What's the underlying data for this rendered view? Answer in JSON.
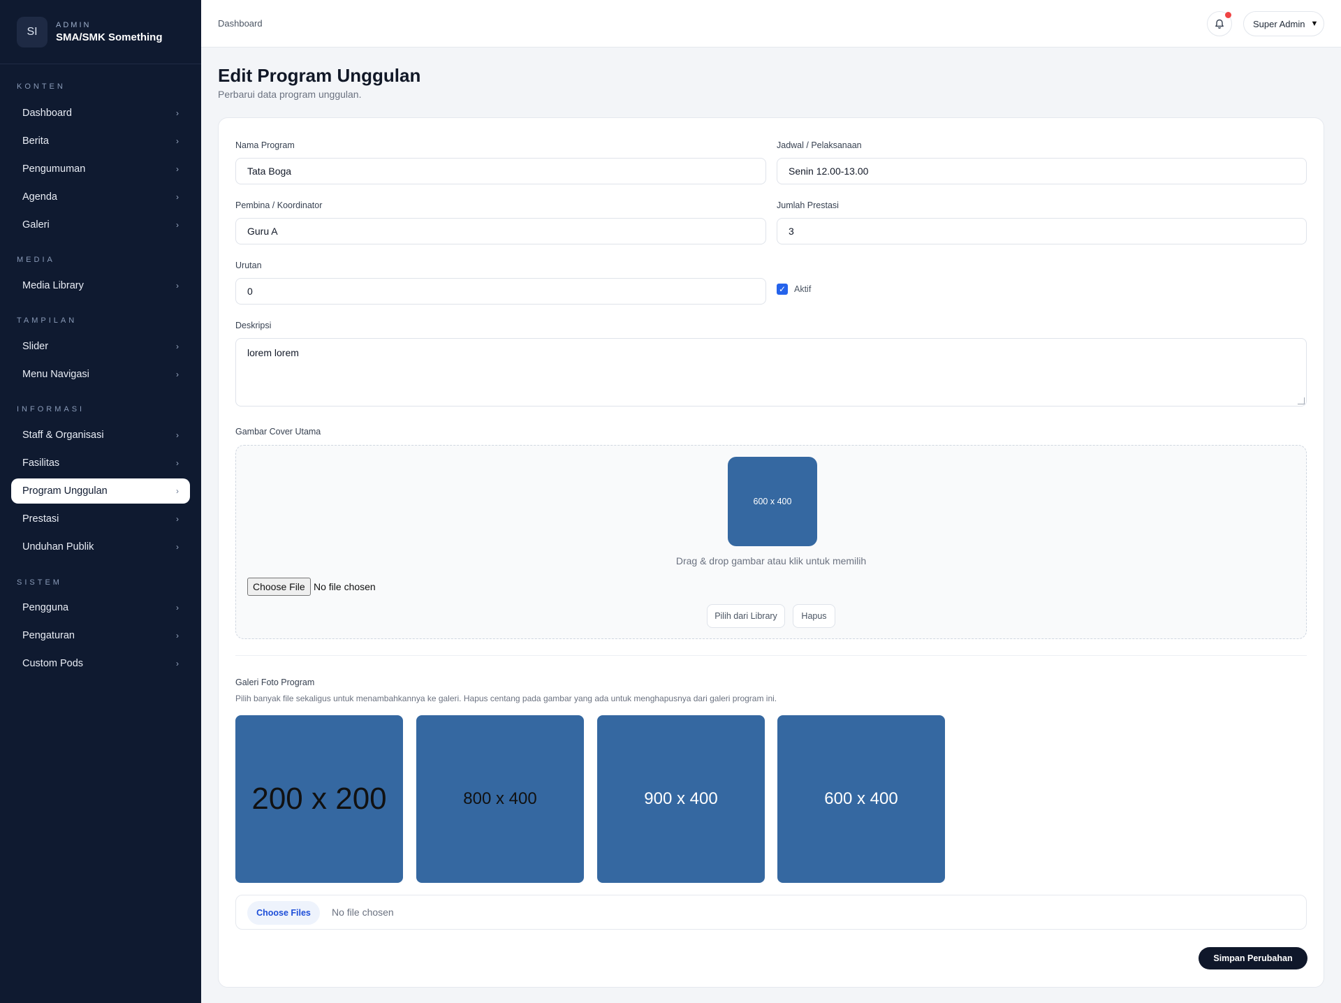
{
  "brand": {
    "logo": "SI",
    "kicker": "ADMIN",
    "name": "SMA/SMK Something"
  },
  "sidebar": {
    "sections": [
      {
        "title": "KONTEN",
        "items": [
          "Dashboard",
          "Berita",
          "Pengumuman",
          "Agenda",
          "Galeri"
        ]
      },
      {
        "title": "MEDIA",
        "items": [
          "Media Library"
        ]
      },
      {
        "title": "TAMPILAN",
        "items": [
          "Slider",
          "Menu Navigasi"
        ]
      },
      {
        "title": "INFORMASI",
        "items": [
          "Staff & Organisasi",
          "Fasilitas",
          "Program Unggulan",
          "Prestasi",
          "Unduhan Publik"
        ]
      },
      {
        "title": "SISTEM",
        "items": [
          "Pengguna",
          "Pengaturan",
          "Custom Pods"
        ]
      }
    ],
    "active": "Program Unggulan",
    "chevron": "›"
  },
  "topbar": {
    "breadcrumb": "Dashboard",
    "bell_icon": "bell-icon",
    "user": "Super Admin",
    "caret": "▼"
  },
  "page": {
    "title": "Edit Program Unggulan",
    "subtitle": "Perbarui data program unggulan."
  },
  "form": {
    "nama_program": {
      "label": "Nama Program",
      "value": "Tata Boga"
    },
    "jadwal": {
      "label": "Jadwal / Pelaksanaan",
      "value": "Senin 12.00-13.00"
    },
    "pembina": {
      "label": "Pembina / Koordinator",
      "value": "Guru A"
    },
    "jumlah_prestasi": {
      "label": "Jumlah Prestasi",
      "value": "3"
    },
    "urutan": {
      "label": "Urutan",
      "value": "0"
    },
    "aktif": {
      "label": "Aktif",
      "checked": true,
      "mark": "✓"
    },
    "deskripsi": {
      "label": "Deskripsi",
      "value": "lorem lorem"
    }
  },
  "cover": {
    "label": "Gambar Cover Utama",
    "image_text": "600 x 400",
    "dropzone_text": "Drag & drop gambar atau klik untuk memilih",
    "file_button": "Choose File",
    "file_status": "No file chosen",
    "library_button": "Pilih dari Library",
    "remove_button": "Hapus"
  },
  "gallery": {
    "title": "Galeri Foto Program",
    "subtitle": "Pilih banyak file sekaligus untuk menambahkannya ke galeri. Hapus centang pada gambar yang ada untuk menghapusnya dari galeri program ini.",
    "images": [
      {
        "text": "200 x 200",
        "color": "#111111"
      },
      {
        "text": "800 x 400",
        "color": "#111111"
      },
      {
        "text": "900 x 400",
        "color": "#ffffff"
      },
      {
        "text": "600 x 400",
        "color": "#ffffff"
      }
    ],
    "files_button": "Choose Files",
    "files_status": "No file chosen"
  },
  "actions": {
    "save": "Simpan Perubahan"
  },
  "colors": {
    "sidebar_bg": "#0f1a30",
    "accent": "#2563eb",
    "placeholder_img": "#3568a1",
    "notification": "#ef4444",
    "primary_button": "#0f172a"
  }
}
